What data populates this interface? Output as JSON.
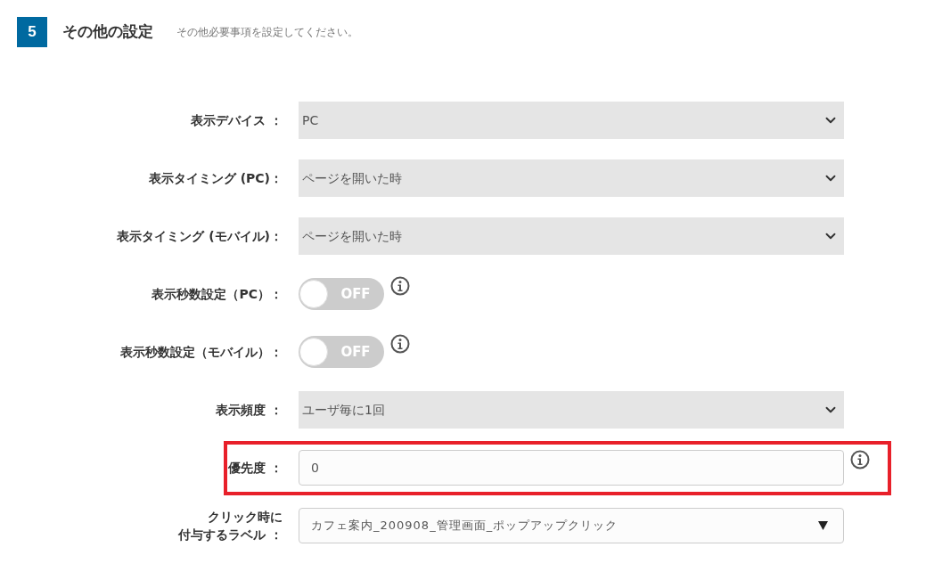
{
  "section": {
    "number": "5",
    "title": "その他の設定",
    "description": "その他必要事項を設定してください。"
  },
  "rows": [
    {
      "kind": "select",
      "label": [
        "表示デバイス ："
      ],
      "value": "PC",
      "info": false,
      "highlighted": false
    },
    {
      "kind": "select",
      "label": [
        "表示タイミング (PC)："
      ],
      "value": "ページを開いた時",
      "info": false,
      "highlighted": false
    },
    {
      "kind": "select",
      "label": [
        "表示タイミング (モバイル)："
      ],
      "value": "ページを開いた時",
      "info": false,
      "highlighted": false
    },
    {
      "kind": "toggle",
      "label": [
        "表示秒数設定（PC）："
      ],
      "value": "OFF",
      "on": false,
      "info": true,
      "highlighted": false
    },
    {
      "kind": "toggle",
      "label": [
        "表示秒数設定（モバイル）："
      ],
      "value": "OFF",
      "on": false,
      "info": true,
      "highlighted": false
    },
    {
      "kind": "select",
      "label": [
        "表示頻度 ："
      ],
      "value": "ユーザ毎に1回",
      "info": false,
      "highlighted": false
    },
    {
      "kind": "input",
      "label": [
        "優先度 ："
      ],
      "value": "0",
      "info": true,
      "highlighted": true
    },
    {
      "kind": "dropdown",
      "label": [
        "クリック時に",
        "付与するラベル ："
      ],
      "value": "カフェ案内_200908_管理画面_ポップアップクリック",
      "info": false,
      "highlighted": false
    }
  ]
}
